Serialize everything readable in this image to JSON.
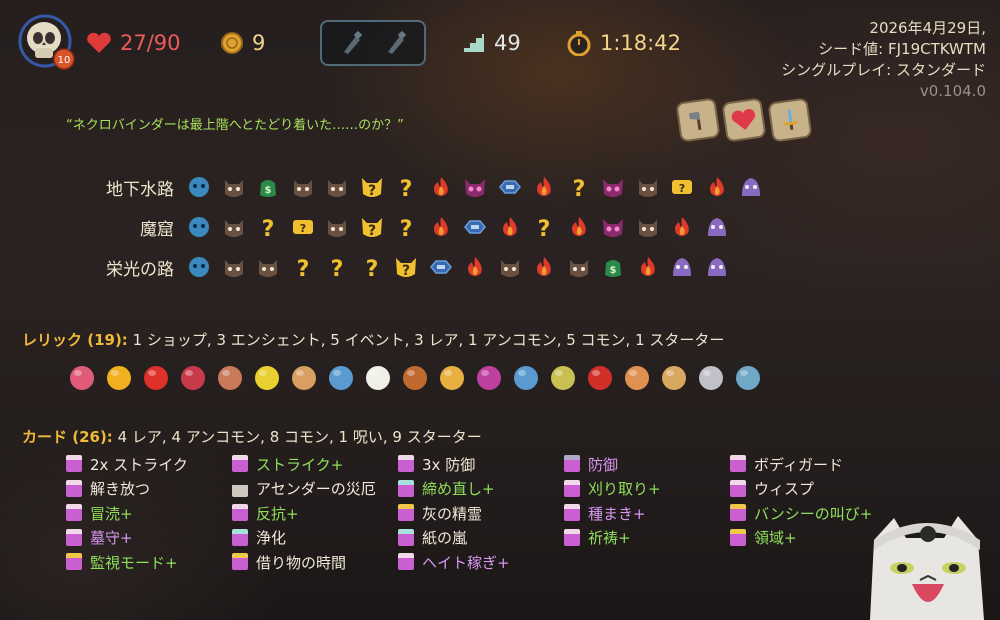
{
  "hud": {
    "hp": "27/90",
    "gold": "9",
    "floor": "49",
    "time": "1:18:42",
    "ascension": "10",
    "potions": [
      "empty-potion-slot",
      "empty-potion-slot"
    ]
  },
  "run_info": {
    "date": "2026年4月29日,",
    "seed": "シード値: FJ19CTKWTM",
    "mode": "シングルプレイ: スタンダード",
    "version": "v0.104.0"
  },
  "quote": "“ネクロバインダーは最上階へとたどり着いた……のか？”",
  "boss_relics": [
    "axe-tile-icon",
    "heart-tile-icon",
    "sword-tile-icon"
  ],
  "acts": [
    {
      "name": "地下水路",
      "nodes": [
        "ancient",
        "monster",
        "treasure",
        "monster",
        "monster",
        "unknown-elite",
        "unknown",
        "rest",
        "elite",
        "shop",
        "rest",
        "unknown",
        "elite",
        "monster",
        "chest",
        "rest",
        "boss"
      ]
    },
    {
      "name": "魔窟",
      "nodes": [
        "ancient",
        "monster",
        "unknown",
        "chest",
        "monster",
        "unknown-elite",
        "unknown",
        "rest",
        "shop",
        "rest",
        "unknown",
        "rest",
        "elite",
        "monster",
        "rest",
        "boss"
      ]
    },
    {
      "name": "栄光の路",
      "nodes": [
        "ancient",
        "monster",
        "monster",
        "unknown",
        "unknown",
        "unknown",
        "unknown-elite",
        "shop",
        "rest",
        "monster",
        "rest",
        "monster",
        "treasure",
        "rest",
        "boss",
        "boss"
      ]
    }
  ],
  "relics": {
    "label": "レリック (19):",
    "summary": "1 ショップ,  3 エンシェント, 5 イベント, 3 レア, 1 アンコモン, 5 コモン, 1 スターター",
    "items": [
      "coral-icon",
      "golden-orb-icon",
      "strawberry-icon",
      "tray-icon",
      "teacup-icon",
      "lemon-icon",
      "pyramid-icon",
      "anchor-icon",
      "white-flower-icon",
      "wooden-box-icon",
      "potted-flower-icon",
      "potion-bottle-icon",
      "anchor-icon",
      "mango-icon",
      "red-flask-icon",
      "cloak-icon",
      "paper-icon",
      "scythe-icon",
      "tag-icon"
    ]
  },
  "cards": {
    "label": "カード (26):",
    "summary": "4 レア, 4 アンコモン, 8 コモン, 1 呪い, 9 スターター",
    "items": [
      {
        "name": "2x ストライク",
        "tone": "white",
        "top": "#f0d8e8",
        "body": "#c95fd0"
      },
      {
        "name": "ストライク+",
        "tone": "green",
        "top": "#f0d8e8",
        "body": "#c95fd0"
      },
      {
        "name": "3x 防御",
        "tone": "white",
        "top": "#f0d8e8",
        "body": "#c95fd0"
      },
      {
        "name": "防御",
        "tone": "purple",
        "top": "#b0a8c8",
        "body": "#c95fd0"
      },
      {
        "name": "ボディガード",
        "tone": "white",
        "top": "#f0d8e8",
        "body": "#c95fd0"
      },
      {
        "name": "解き放つ",
        "tone": "white",
        "top": "#f0d8e8",
        "body": "#c95fd0"
      },
      {
        "name": "アセンダーの災厄",
        "tone": "white",
        "top": "#222222",
        "body": "#d0c8c0"
      },
      {
        "name": "締め直し+",
        "tone": "green",
        "top": "#a8e0e0",
        "body": "#c95fd0"
      },
      {
        "name": "刈り取り+",
        "tone": "green",
        "top": "#f0d8e8",
        "body": "#c95fd0"
      },
      {
        "name": "ウィスプ",
        "tone": "white",
        "top": "#f0d8e8",
        "body": "#c95fd0"
      },
      {
        "name": "冒涜+",
        "tone": "green",
        "top": "#f0d8e8",
        "body": "#c95fd0"
      },
      {
        "name": "反抗+",
        "tone": "green",
        "top": "#f0d8e8",
        "body": "#c95fd0"
      },
      {
        "name": "灰の精霊",
        "tone": "white",
        "top": "#f0c848",
        "body": "#c95fd0"
      },
      {
        "name": "種まき+",
        "tone": "purple",
        "top": "#f0d8e8",
        "body": "#c95fd0"
      },
      {
        "name": "バンシーの叫び+",
        "tone": "green",
        "top": "#f0c848",
        "body": "#c95fd0"
      },
      {
        "name": "墓守+",
        "tone": "purple",
        "top": "#f0d8e8",
        "body": "#c95fd0"
      },
      {
        "name": "浄化",
        "tone": "white",
        "top": "#a8e0e0",
        "body": "#c95fd0"
      },
      {
        "name": "紙の嵐",
        "tone": "white",
        "top": "#a8e0e0",
        "body": "#c95fd0"
      },
      {
        "name": "祈祷+",
        "tone": "green",
        "top": "#f0d8e8",
        "body": "#c95fd0"
      },
      {
        "name": "領域+",
        "tone": "green",
        "top": "#f0c848",
        "body": "#c95fd0"
      },
      {
        "name": "監視モード+",
        "tone": "green",
        "top": "#f0c848",
        "body": "#c95fd0"
      },
      {
        "name": "借り物の時間",
        "tone": "white",
        "top": "#f0c848",
        "body": "#c95fd0"
      },
      {
        "name": "ヘイト稼ぎ+",
        "tone": "purple",
        "top": "#f0d8e8",
        "body": "#c95fd0"
      }
    ]
  },
  "colors": {
    "accent_gold": "#f0b93a",
    "hp_red": "#ee5a5a",
    "upgrade_green": "#8ee05a",
    "enchant_purple": "#d896f0"
  }
}
